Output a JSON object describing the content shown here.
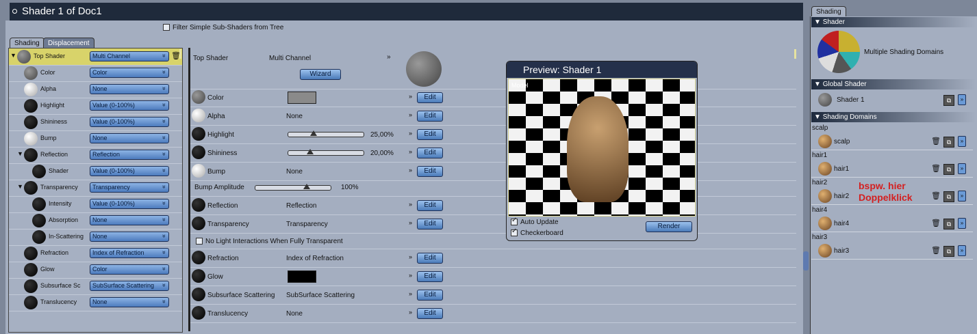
{
  "window_title": "Shader 1 of Doc1",
  "filter_label": "Filter Simple Sub-Shaders from Tree",
  "tabs": [
    "Shading",
    "Displacement"
  ],
  "tree": [
    {
      "label": "Top Shader",
      "value": "Multi Channel",
      "ball": "gray",
      "indent": 0
    },
    {
      "label": "Color",
      "value": "Color",
      "ball": "gray",
      "indent": 1
    },
    {
      "label": "Alpha",
      "value": "None",
      "ball": "white",
      "indent": 1
    },
    {
      "label": "Highlight",
      "value": "Value (0-100%)",
      "ball": "black",
      "indent": 1
    },
    {
      "label": "Shininess",
      "value": "Value (0-100%)",
      "ball": "black",
      "indent": 1
    },
    {
      "label": "Bump",
      "value": "None",
      "ball": "white",
      "indent": 1
    },
    {
      "label": "Reflection",
      "value": "Reflection",
      "ball": "black",
      "indent": 1
    },
    {
      "label": "Shader",
      "value": "Value (0-100%)",
      "ball": "black",
      "indent": 2
    },
    {
      "label": "Transparency",
      "value": "Transparency",
      "ball": "black",
      "indent": 1
    },
    {
      "label": "Intensity",
      "value": "Value (0-100%)",
      "ball": "black",
      "indent": 2
    },
    {
      "label": "Absorption",
      "value": "None",
      "ball": "black",
      "indent": 2
    },
    {
      "label": "In-Scattering",
      "value": "None",
      "ball": "black",
      "indent": 2
    },
    {
      "label": "Refraction",
      "value": "Index of Refraction",
      "ball": "black",
      "indent": 1
    },
    {
      "label": "Glow",
      "value": "Color",
      "ball": "black",
      "indent": 1
    },
    {
      "label": "Subsurface Sc",
      "value": "SubSurface Scattering",
      "ball": "black",
      "indent": 1
    },
    {
      "label": "Translucency",
      "value": "None",
      "ball": "black",
      "indent": 1
    }
  ],
  "top_shader": {
    "label": "Top Shader",
    "value": "Multi Channel",
    "wizard": "Wizard"
  },
  "edit_label": "Edit",
  "channels": [
    {
      "label": "Color",
      "type": "swatch",
      "swatch": "#8a8a8a",
      "ball": "gray"
    },
    {
      "label": "Alpha",
      "type": "text",
      "value": "None",
      "ball": "white"
    },
    {
      "label": "Highlight",
      "type": "slider",
      "value": "25,00%",
      "fraction": 0.25,
      "ball": "black"
    },
    {
      "label": "Shininess",
      "type": "slider",
      "value": "20,00%",
      "fraction": 0.2,
      "ball": "black"
    },
    {
      "label": "Bump",
      "type": "text",
      "value": "None",
      "ball": "white"
    },
    {
      "label": "Reflection",
      "type": "text",
      "value": "Reflection",
      "ball": "black"
    },
    {
      "label": "Transparency",
      "type": "text",
      "value": "Transparency",
      "ball": "black"
    },
    {
      "label": "Refraction",
      "type": "text",
      "value": "Index of Refraction",
      "ball": "black"
    },
    {
      "label": "Glow",
      "type": "swatch",
      "swatch": "#000000",
      "ball": "black"
    },
    {
      "label": "Subsurface Scattering",
      "type": "text",
      "value": "SubSurface Scattering",
      "ball": "black"
    },
    {
      "label": "Translucency",
      "type": "text",
      "value": "None",
      "ball": "black"
    }
  ],
  "bump_amplitude": {
    "label": "Bump Amplitude",
    "value": "100%",
    "fraction": 1.0
  },
  "no_light_label": "No Light Interactions When Fully Transparent",
  "preview": {
    "title": "Preview: Shader 1",
    "overlay": "Model",
    "auto_update": "Auto Update",
    "checkerboard": "Checkerboard",
    "render": "Render"
  },
  "side": {
    "tab": "Shading",
    "shader_header": "Shader",
    "shader_name": "Multiple Shading Domains",
    "global_header": "Global Shader",
    "global_name": "Shader 1",
    "domains_header": "Shading Domains",
    "domains": [
      {
        "group": "scalp",
        "name": "scalp"
      },
      {
        "group": "hair1",
        "name": "hair1"
      },
      {
        "group": "hair2",
        "name": "hair2"
      },
      {
        "group": "hair4",
        "name": "hair4"
      },
      {
        "group": "hair3",
        "name": "hair3"
      }
    ],
    "annotation_line1": "bspw. hier",
    "annotation_line2": "Doppelklick"
  }
}
